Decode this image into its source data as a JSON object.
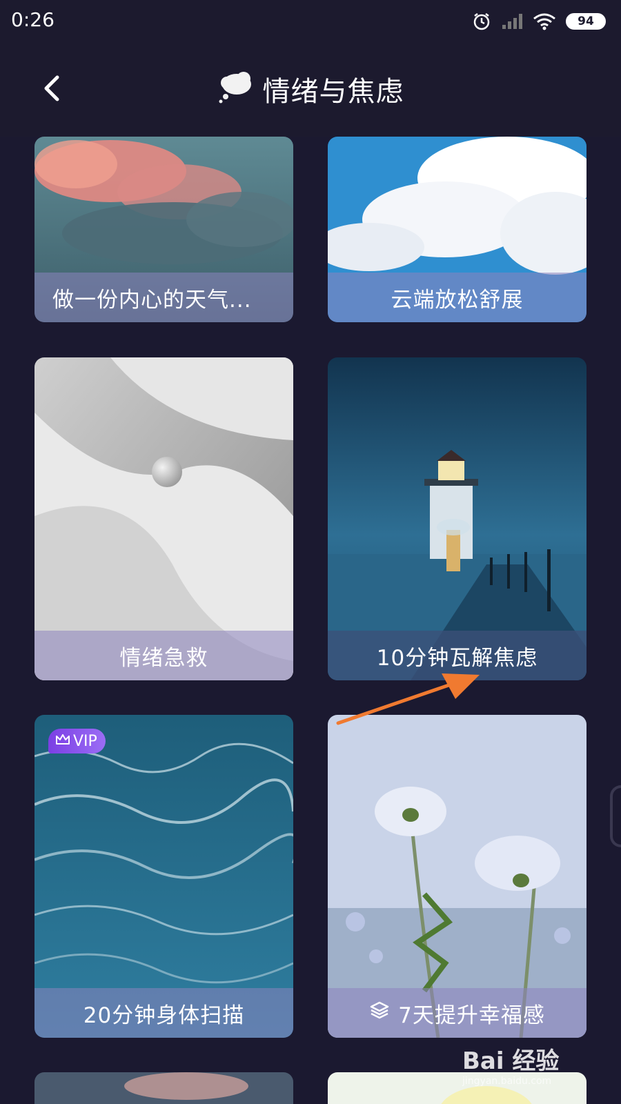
{
  "status_bar": {
    "time": "0:26",
    "battery": "94",
    "icons": [
      "alarm-icon",
      "signal-icon",
      "wifi-icon",
      "battery-icon"
    ]
  },
  "header": {
    "title": "情绪与焦虑",
    "back_icon": "chevron-left-icon",
    "title_icon": "thought-bubble-icon"
  },
  "cards": [
    {
      "title": "做一份内心的天气...",
      "art": "pink-clouds"
    },
    {
      "title": "云端放松舒展",
      "art": "white-clouds"
    },
    {
      "title": "情绪急救",
      "art": "gray-waves"
    },
    {
      "title": "10分钟瓦解焦虑",
      "art": "lighthouse"
    },
    {
      "title": "20分钟身体扫描",
      "art": "ocean",
      "badge": "VIP"
    },
    {
      "title": "7天提升幸福感",
      "art": "flowers",
      "icon": "layers-icon"
    }
  ],
  "watermark": {
    "main": "Bai 经验",
    "sub": "jingyan.baidu.com"
  },
  "colors": {
    "background": "#1b1930",
    "caption_overlay": "#8c84be",
    "vip_badge": "#7b3fe4",
    "arrow": "#f07a30"
  }
}
